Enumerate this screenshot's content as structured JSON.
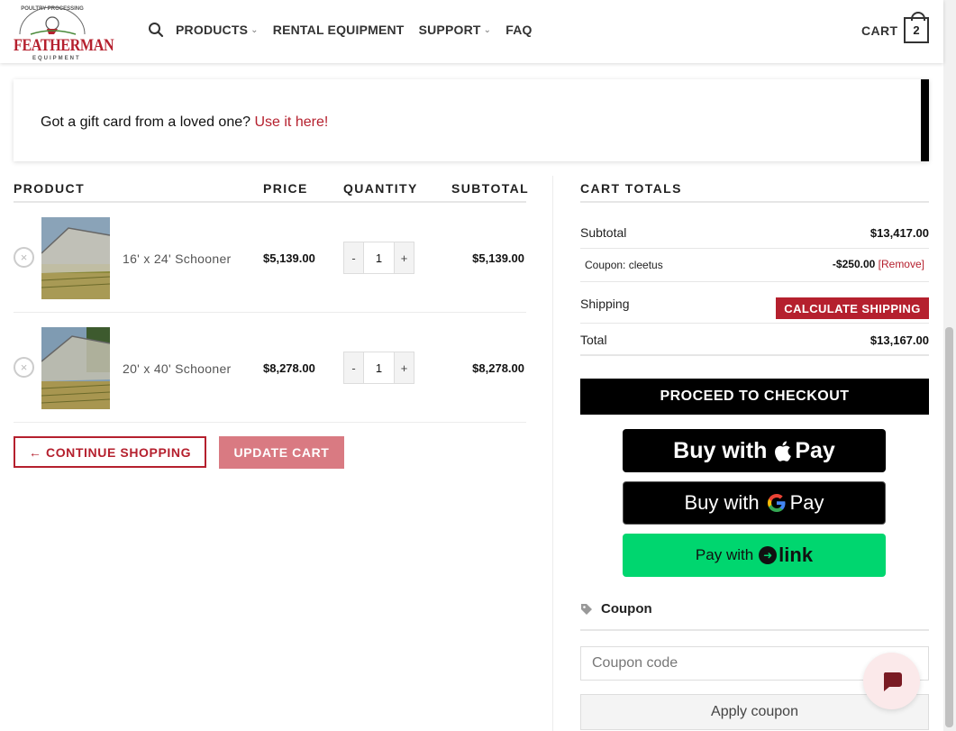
{
  "header": {
    "logo_arc_text": "POULTRY PROCESSING",
    "logo_text": "FEATHERMAN",
    "logo_sub": "EQUIPMENT",
    "nav": [
      {
        "label": "PRODUCTS",
        "has_dropdown": true
      },
      {
        "label": "RENTAL EQUIPMENT",
        "has_dropdown": false
      },
      {
        "label": "SUPPORT",
        "has_dropdown": true
      },
      {
        "label": "FAQ",
        "has_dropdown": false
      }
    ],
    "cart_label": "CART",
    "cart_count": "2"
  },
  "notice": {
    "text": "Got a gift card from a loved one?",
    "link": "Use it here!"
  },
  "cart_table": {
    "headers": {
      "product": "PRODUCT",
      "price": "PRICE",
      "quantity": "QUANTITY",
      "subtotal": "SUBTOTAL"
    },
    "items": [
      {
        "name": "16' x 24' Schooner",
        "price": "$5,139.00",
        "quantity": "1",
        "subtotal": "$5,139.00"
      },
      {
        "name": "20' x 40' Schooner",
        "price": "$8,278.00",
        "quantity": "1",
        "subtotal": "$8,278.00"
      }
    ],
    "qty_minus": "-",
    "qty_plus": "+",
    "remove_symbol": "×",
    "continue_label": "← CONTINUE SHOPPING",
    "update_label": "UPDATE CART"
  },
  "totals": {
    "title": "CART TOTALS",
    "subtotal_label": "Subtotal",
    "subtotal_value": "$13,417.00",
    "coupon_label": "Coupon: cleetus",
    "coupon_value": "-$250.00",
    "coupon_remove": "[Remove]",
    "shipping_label": "Shipping",
    "calc_shipping": "CALCULATE SHIPPING",
    "total_label": "Total",
    "total_value": "$13,167.00",
    "checkout_label": "PROCEED TO CHECKOUT",
    "apple_pay": {
      "prefix": "Buy with",
      "brand": "Pay"
    },
    "google_pay": {
      "prefix": "Buy with",
      "brand": "Pay"
    },
    "link_pay": {
      "prefix": "Pay with",
      "brand": "link"
    }
  },
  "coupon": {
    "heading": "Coupon",
    "placeholder": "Coupon code",
    "apply_label": "Apply coupon"
  },
  "colors": {
    "brand": "#b5202e",
    "link_green": "#00d66f"
  }
}
